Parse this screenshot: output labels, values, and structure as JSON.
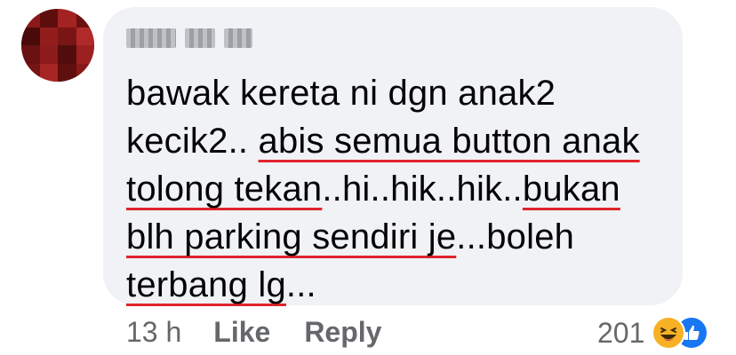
{
  "comment": {
    "author_name": "Fiona D.",
    "lines": [
      [
        {
          "t": "bawak kereta ni dgn anak2",
          "hl": false
        }
      ],
      [
        {
          "t": "kecik2.. ",
          "hl": false
        },
        {
          "t": "abis semua button anak",
          "hl": true
        }
      ],
      [
        {
          "t": "tolong tekan",
          "hl": true
        },
        {
          "t": "..hi..hik..hik..",
          "hl": false
        },
        {
          "t": "bukan",
          "hl": true
        }
      ],
      [
        {
          "t": "blh parking sendiri je",
          "hl": true
        },
        {
          "t": "...boleh",
          "hl": false
        }
      ],
      [
        {
          "t": "terbang lg",
          "hl": true
        },
        {
          "t": "...",
          "hl": false
        }
      ]
    ],
    "underline_color": "#e0242c"
  },
  "meta": {
    "time": "13 h",
    "like_label": "Like",
    "reply_label": "Reply",
    "reaction_count": "201",
    "reaction_icons": [
      "haha-icon",
      "like-icon"
    ]
  },
  "colors": {
    "bubble_bg": "#f0f2f5",
    "meta_text": "#65676b",
    "like_blue": "#1877f2",
    "haha_yellow": "#f7b125"
  }
}
